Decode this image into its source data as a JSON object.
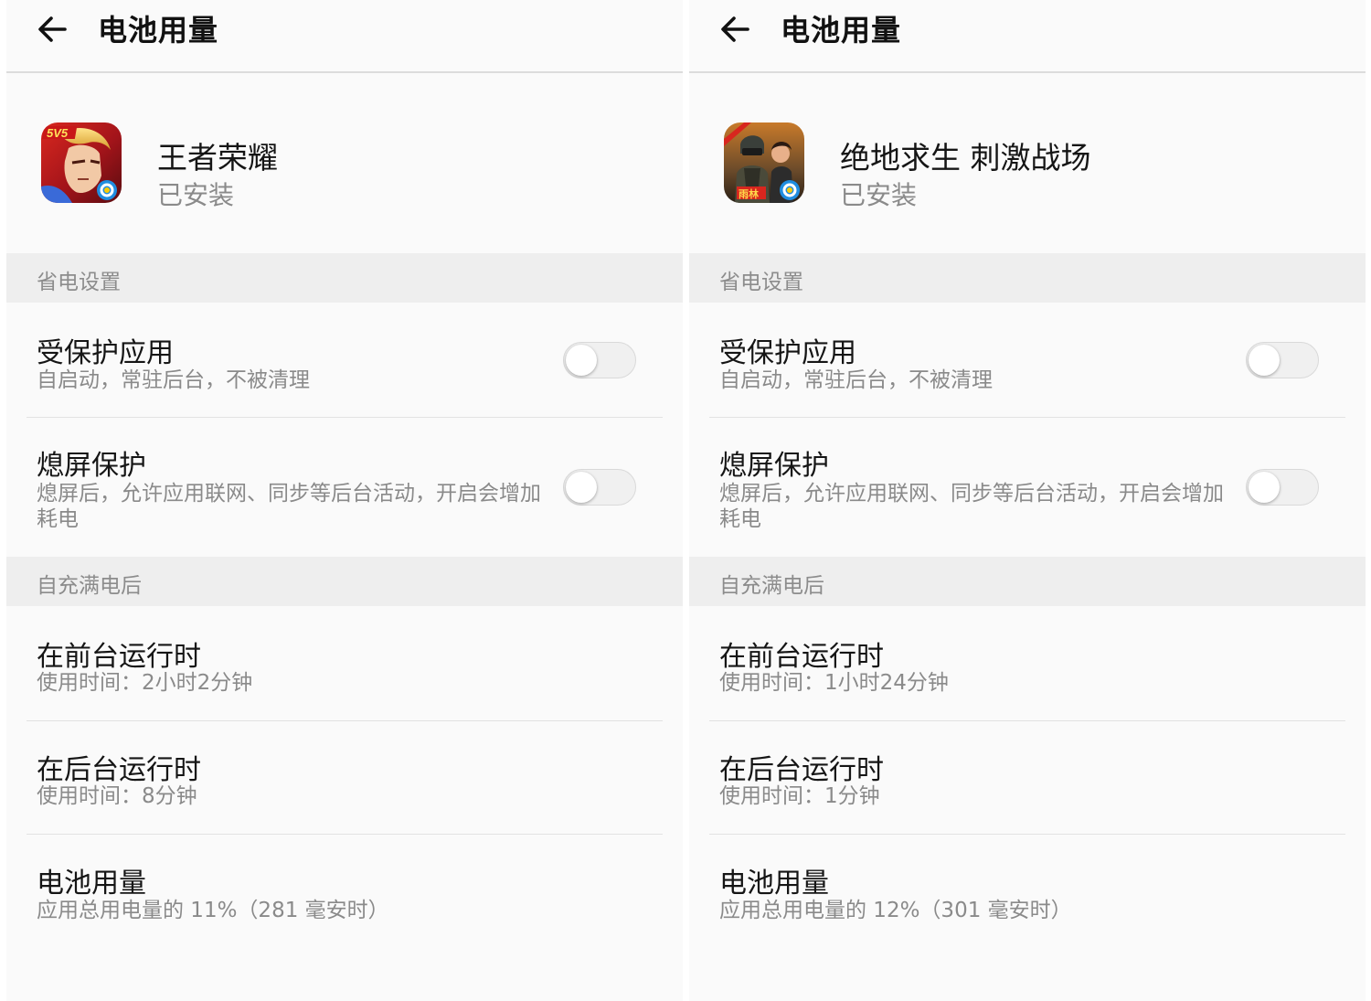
{
  "panels": [
    {
      "header": {
        "title": "电池用量"
      },
      "app": {
        "name": "王者荣耀",
        "status": "已安装",
        "icon": "honor-of-kings-icon",
        "badge": "5V5"
      },
      "sections": {
        "power_saving": "省电设置",
        "since_full_charge": "自充满电后"
      },
      "protected_app": {
        "title": "受保护应用",
        "subtitle": "自启动，常驻后台，不被清理",
        "enabled": false
      },
      "screen_off": {
        "title": "熄屏保护",
        "subtitle": "熄屏后，允许应用联网、同步等后台活动，开启会增加耗电",
        "enabled": false
      },
      "foreground": {
        "title": "在前台运行时",
        "subtitle": "使用时间：2小时2分钟"
      },
      "background": {
        "title": "在后台运行时",
        "subtitle": "使用时间：8分钟"
      },
      "battery": {
        "title": "电池用量",
        "subtitle": "应用总用电量的 11%（281 毫安时）"
      }
    },
    {
      "header": {
        "title": "电池用量"
      },
      "app": {
        "name": "绝地求生 刺激战场",
        "status": "已安装",
        "icon": "pubg-mobile-icon",
        "badge": "雨林"
      },
      "sections": {
        "power_saving": "省电设置",
        "since_full_charge": "自充满电后"
      },
      "protected_app": {
        "title": "受保护应用",
        "subtitle": "自启动，常驻后台，不被清理",
        "enabled": false
      },
      "screen_off": {
        "title": "熄屏保护",
        "subtitle": "熄屏后，允许应用联网、同步等后台活动，开启会增加耗电",
        "enabled": false
      },
      "foreground": {
        "title": "在前台运行时",
        "subtitle": "使用时间：1小时24分钟"
      },
      "background": {
        "title": "在后台运行时",
        "subtitle": "使用时间：1分钟"
      },
      "battery": {
        "title": "电池用量",
        "subtitle": "应用总用电量的 12%（301 毫安时）"
      }
    }
  ],
  "icons": {
    "back": "arrow-left-icon"
  },
  "colors": {
    "section_bg": "#eeeeee",
    "divider": "#e2e2e2",
    "secondary_text": "#8a8a8a"
  }
}
